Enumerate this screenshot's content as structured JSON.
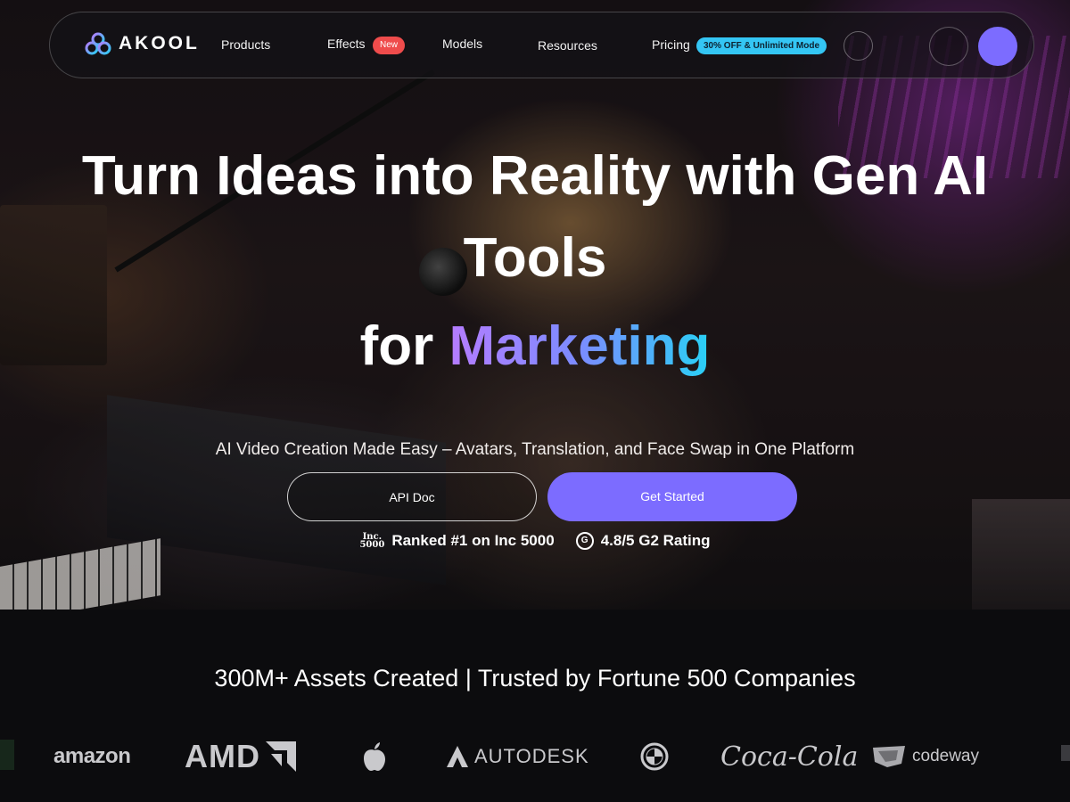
{
  "nav": {
    "logo_text": "AKOOL",
    "items": [
      {
        "label": "Products"
      },
      {
        "label": "Effects",
        "badge": "New"
      },
      {
        "label": "Models"
      },
      {
        "label": "Resources"
      },
      {
        "label": "Pricing",
        "badge": "30% OFF & Unlimited Mode"
      }
    ]
  },
  "hero": {
    "headline_line1": "Turn Ideas into Reality with Gen AI Tools",
    "headline_for": "for ",
    "headline_highlight": "Marketing",
    "subtitle": "AI Video Creation Made Easy – Avatars, Translation, and Face Swap in One Platform",
    "buttons": {
      "api_doc": "API Doc",
      "get_started": "Get Started"
    },
    "ratings": [
      {
        "logo_text": "Inc. 5000",
        "label": "Ranked #1 on Inc 5000"
      },
      {
        "logo_text": "G2",
        "label": "4.8/5 G2 Rating"
      }
    ]
  },
  "trust": {
    "title": "300M+ Assets Created | Trusted by Fortune 500 Companies",
    "brands": [
      "amazon",
      "AMD",
      "apple-logo",
      "AUTODESK",
      "bmw-logo",
      "Coca-Cola",
      "codeway"
    ]
  },
  "colors": {
    "accent": "#7c6cff",
    "new_badge": "#ef4c4c",
    "offer_badge": "#34c6f4",
    "gradient_start": "#b57cff",
    "gradient_end": "#29d0f5",
    "background_dark": "#0c0c0e"
  },
  "icons": [
    "akool-logo-icon",
    "inc5000-logo-icon",
    "g2-logo-icon",
    "apple-logo-icon",
    "bmw-logo-icon",
    "amd-arrow-icon",
    "autodesk-logo-icon",
    "codeway-logo-icon"
  ]
}
